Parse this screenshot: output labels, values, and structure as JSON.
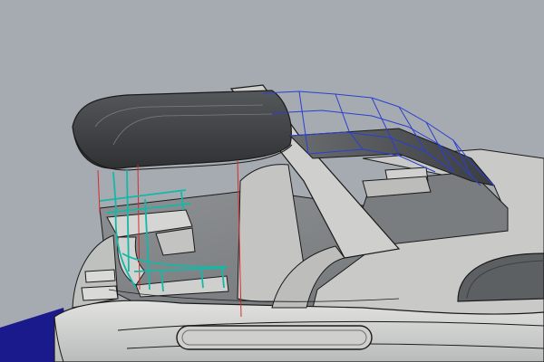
{
  "viewport": {
    "kind": "3d-modeling-viewport",
    "background_color": "#a6abb1",
    "shading": "shaded-with-edges",
    "objects": [
      "hardtop-roof",
      "roof-support-arch",
      "wireframe-glass-canopy",
      "cyan-railing-curves",
      "red-vertical-construction-lines",
      "flybridge-seating",
      "main-deck-superstructure",
      "side-window",
      "hull-porthole-slot",
      "water-plane"
    ],
    "colors": {
      "hull": "#d7d8d6",
      "deck": "#85888a",
      "roof": "#3c3e40",
      "cyan_curves": "#14b8a6",
      "blue_wireframe": "#2a3fd1",
      "red_lines": "#d62b2b",
      "water": "#1a1a8c",
      "edges": "#1a1a1a"
    }
  }
}
